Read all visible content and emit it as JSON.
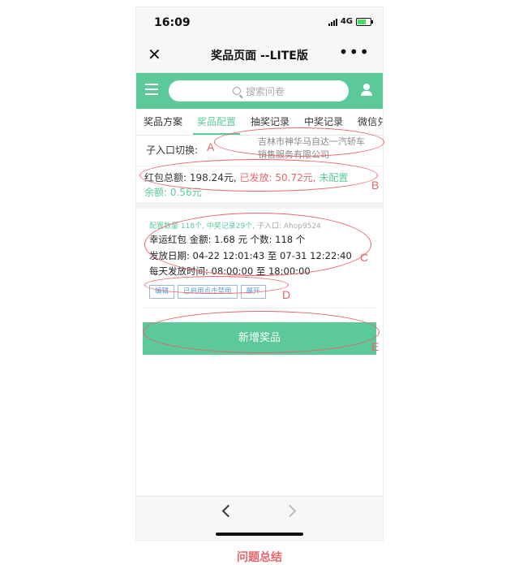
{
  "status": {
    "time": "16:09",
    "network": "4G"
  },
  "titlebar": {
    "title": "奖品页面 --LITE版",
    "more": "•••"
  },
  "header": {
    "search_placeholder": "搜索问卷"
  },
  "tabs": [
    "奖品方案",
    "奖品配置",
    "抽奖记录",
    "中奖记录",
    "微信兑"
  ],
  "entry": {
    "label": "子入口切换:",
    "company": "吉林市神华马自达一汽轿车销售服务有限公司"
  },
  "redbag": {
    "total_label": "红包总额:",
    "total_value": "198.24元,",
    "issued": "已发放: 50.72元,",
    "unallocated_label": "未配置",
    "balance": "余额: 0.56元"
  },
  "card": {
    "meta_count": "配置数量 118个,",
    "meta_records": "中奖记录29个,",
    "meta_entry": "子入口: Ahop9524",
    "line1": "幸运红包  金额: 1.68 元  个数: 118 个",
    "line2": "发放日期: 04-22 12:01:43 至 07-31 12:22:40",
    "line3": "每天发放时间: 08:00:00 至 18:00:00",
    "buttons": [
      "编辑",
      "已启用点击禁用",
      "展开"
    ]
  },
  "add_button": "新增奖品",
  "annotations": {
    "a": "A",
    "b": "B",
    "c": "C",
    "d": "D",
    "e": "E"
  },
  "caption": "问题总结",
  "colors": {
    "accent": "#5cc99b",
    "annotation": "#e8656b"
  }
}
